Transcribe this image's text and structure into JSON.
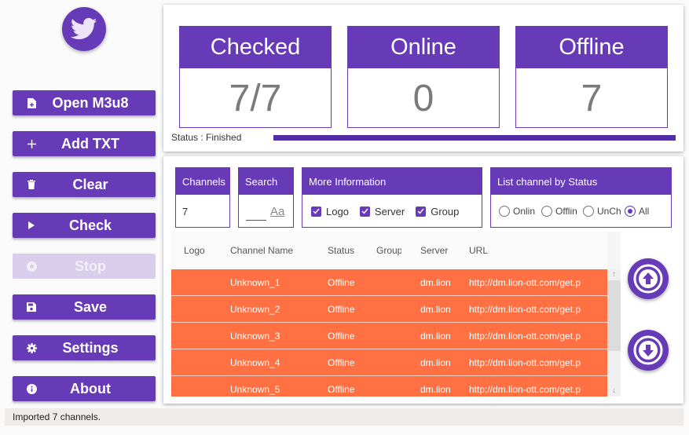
{
  "sidebar": {
    "logo_icon": "twitter-bird-icon",
    "buttons": [
      {
        "label": "Open M3u8",
        "icon": "file-add-icon",
        "enabled": true
      },
      {
        "label": "Add TXT",
        "icon": "plus-icon",
        "enabled": true
      },
      {
        "label": "Clear",
        "icon": "trash-icon",
        "enabled": true
      },
      {
        "label": "Check",
        "icon": "play-icon",
        "enabled": true
      },
      {
        "label": "Stop",
        "icon": "stop-circle-icon",
        "enabled": false
      },
      {
        "label": "Save",
        "icon": "floppy-icon",
        "enabled": true
      },
      {
        "label": "Settings",
        "icon": "gear-icon",
        "enabled": true
      },
      {
        "label": "About",
        "icon": "info-icon",
        "enabled": true
      }
    ]
  },
  "stats": {
    "checked": {
      "label": "Checked",
      "value": "7/7"
    },
    "online": {
      "label": "Online",
      "value": "0"
    },
    "offline": {
      "label": "Offline",
      "value": "7"
    }
  },
  "status": {
    "text": "Status : Finished",
    "progress_percent": 100
  },
  "filters": {
    "channels": {
      "label": "Channels",
      "value": "7"
    },
    "search": {
      "label": "Search",
      "value": "",
      "case_icon": "Aa"
    },
    "more_info": {
      "label": "More Information",
      "options": [
        {
          "label": "Logo",
          "checked": true
        },
        {
          "label": "Server",
          "checked": true
        },
        {
          "label": "Group",
          "checked": true
        }
      ]
    },
    "list_by_status": {
      "label": "List channel by Status",
      "options": [
        {
          "label": "Onlin",
          "selected": false
        },
        {
          "label": "Offlin",
          "selected": false
        },
        {
          "label": "UnCh",
          "selected": false
        },
        {
          "label": "All",
          "selected": true
        }
      ]
    }
  },
  "table": {
    "columns": [
      "Logo",
      "Channel Name",
      "Status",
      "Group",
      "Server",
      "URL"
    ],
    "rows": [
      {
        "logo": "",
        "name": "Unknown_1",
        "status": "Offline",
        "group": "",
        "server": "dm.lion-ott.com",
        "url": "http://dm.lion-ott.com/get.p"
      },
      {
        "logo": "",
        "name": "Unknown_2",
        "status": "Offline",
        "group": "",
        "server": "dm.lion-ott.com",
        "url": "http://dm.lion-ott.com/get.p"
      },
      {
        "logo": "",
        "name": "Unknown_3",
        "status": "Offline",
        "group": "",
        "server": "dm.lion-ott.com",
        "url": "http://dm.lion-ott.com/get.p"
      },
      {
        "logo": "",
        "name": "Unknown_4",
        "status": "Offline",
        "group": "",
        "server": "dm.lion-ott.com",
        "url": "http://dm.lion-ott.com/get.p"
      },
      {
        "logo": "",
        "name": "Unknown_5",
        "status": "Offline",
        "group": "",
        "server": "dm.lion-ott.com",
        "url": "http://dm.lion-ott.com/get.p"
      }
    ],
    "row_color": "#ff7043"
  },
  "nav": {
    "up_icon": "arrow-up-circle-icon",
    "down_icon": "arrow-down-circle-icon"
  },
  "statusbar": {
    "text": "Imported 7 channels."
  },
  "colors": {
    "accent": "#673ab7",
    "offline_row": "#ff7043"
  }
}
